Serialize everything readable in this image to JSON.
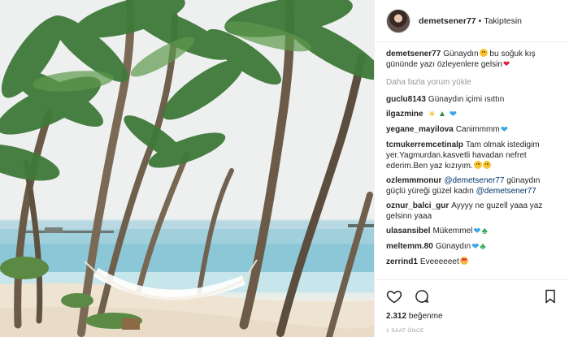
{
  "post": {
    "author": "demetsener77",
    "separator": "•",
    "follow_status": "Takiptesin",
    "caption_text": "Günaydın",
    "caption_rest": "bu soğuk kış gününde yazı özleyenlere gelsin",
    "load_more": "Daha fazla yorum yükle",
    "likes_count": "2.312",
    "likes_label": "beğenme",
    "time_ago": "1 SAAT ÖNCE",
    "photo_alt": "Tropical beach with palm trees and a hammock"
  },
  "comments": [
    {
      "user": "guclu8143",
      "text": "Günaydın içimi ısıttın",
      "emoji": []
    },
    {
      "user": "ilgazmine",
      "text": "",
      "emoji": [
        "sun-emoji",
        "palm-emoji",
        "blue-heart-emoji"
      ]
    },
    {
      "user": "yegane_mayilova",
      "text": "Canimmmm",
      "emoji": [
        "blue-heart-emoji"
      ]
    },
    {
      "user": "tcmukerremcetinalp",
      "text": "Tam olmak istedigim yer.Yagmurdan.kasvetli havadan nefret ederim.Ben yaz kızıyım.",
      "emoji": [
        "smile-emoji",
        "smile-emoji"
      ]
    },
    {
      "user": "ozlemmmonur",
      "mention1": "@demetsener77",
      "text": "günaydın güçlü yüreği güzel kadın",
      "mention2": "@demetsener77"
    },
    {
      "user": "oznur_balci_gur",
      "text": "Ayyyy ne guzell yaaa yaz gelsinn yaaa",
      "emoji": []
    },
    {
      "user": "ulasansibel",
      "text": "Mükemmel",
      "emoji": [
        "blue-heart-emoji",
        "clover-emoji"
      ]
    },
    {
      "user": "meltemm.80",
      "text": "Günaydın",
      "emoji": [
        "blue-heart-emoji",
        "clover-emoji"
      ]
    },
    {
      "user": "zerrind1",
      "text": "Eveeeeeet",
      "emoji": [
        "love-face-emoji"
      ]
    }
  ],
  "colors": {
    "text": "#262626",
    "muted": "#999999",
    "link": "#003569",
    "border": "#efefef",
    "heart_red": "#e21f3d",
    "heart_blue": "#3aa7e6"
  }
}
